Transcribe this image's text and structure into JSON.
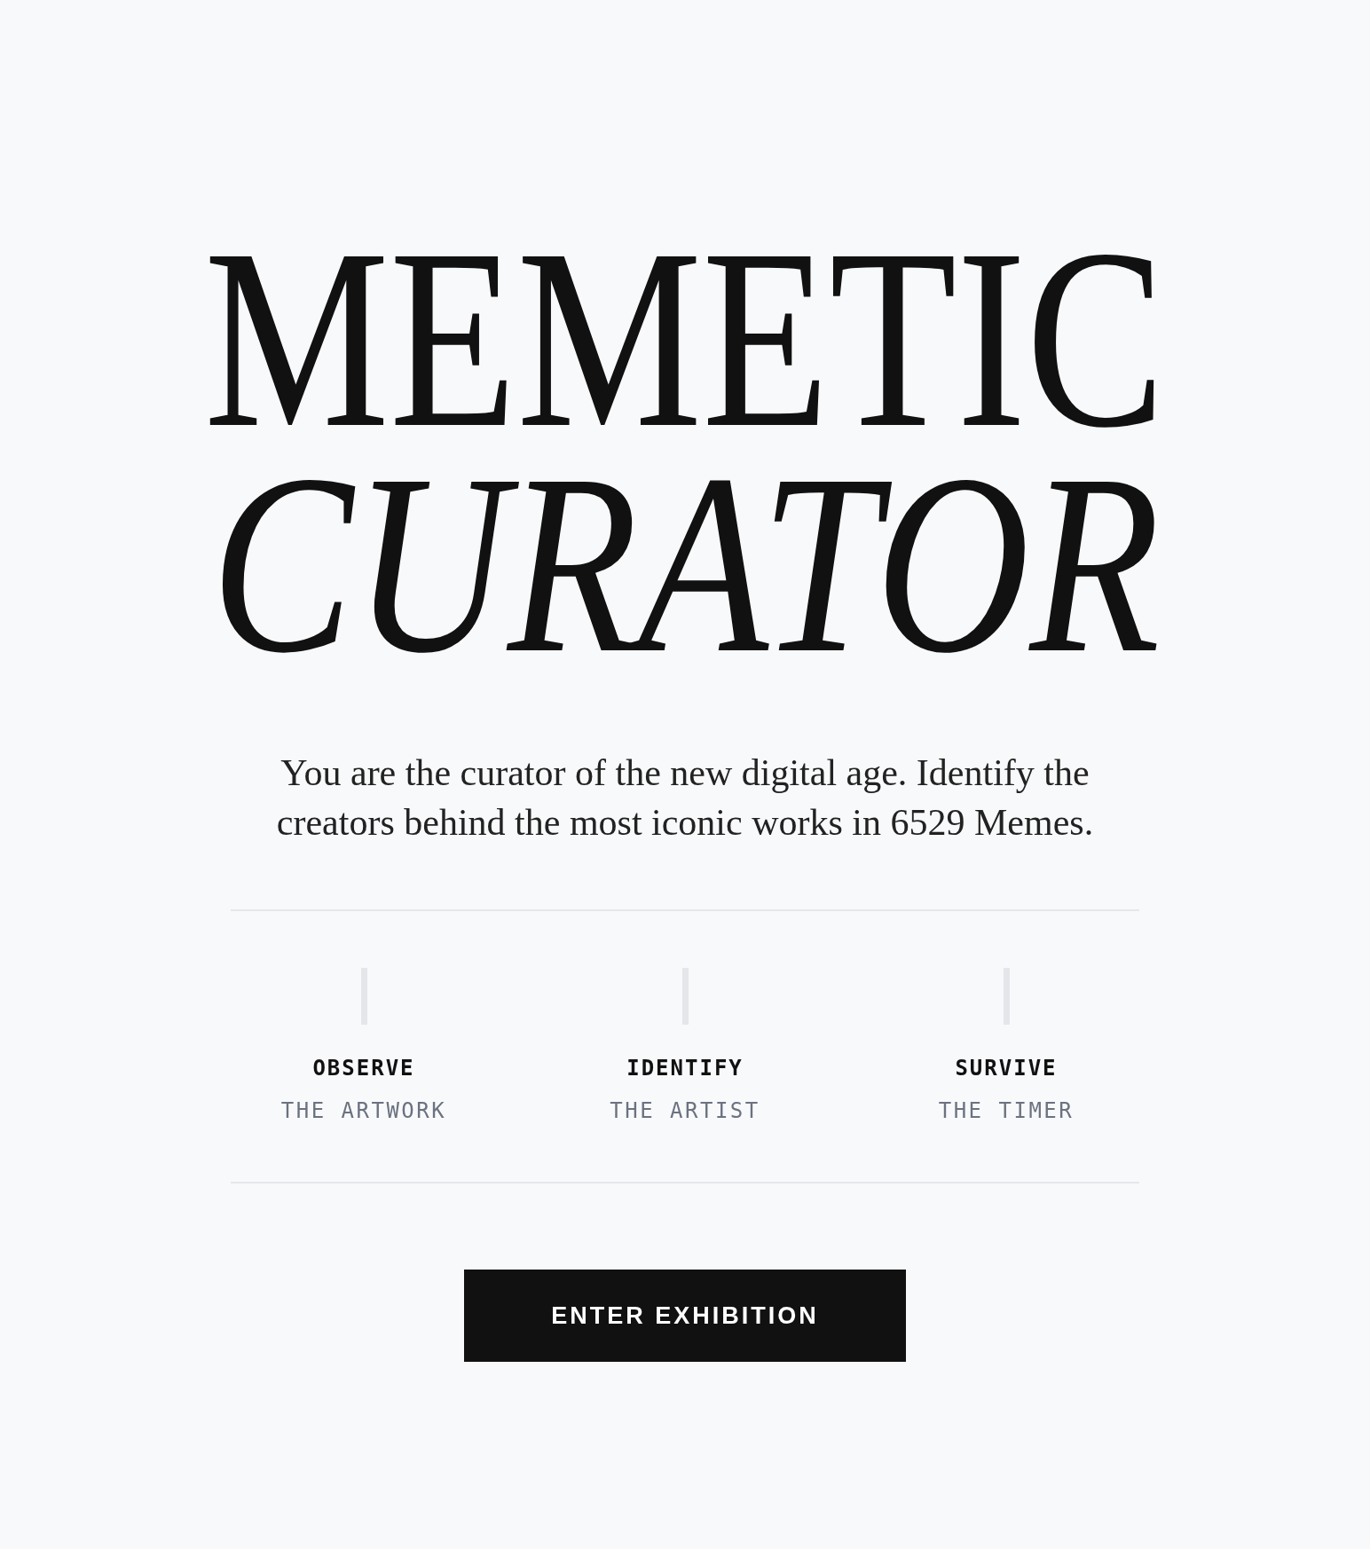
{
  "title_lines": [
    {
      "kind": "upright",
      "text": "MEMETIC"
    },
    {
      "kind": "italic",
      "text": "CURATOR"
    }
  ],
  "intro": "You are the curator of the new digital age. Identify the creators behind the most iconic works in 6529 Memes.",
  "steps": [
    {
      "verb": "OBSERVE",
      "object": "THE ARTWORK"
    },
    {
      "verb": "IDENTIFY",
      "object": "THE ARTIST"
    },
    {
      "verb": "SURVIVE",
      "object": "THE TIMER"
    }
  ],
  "button": {
    "label": "ENTER EXHIBITION"
  }
}
